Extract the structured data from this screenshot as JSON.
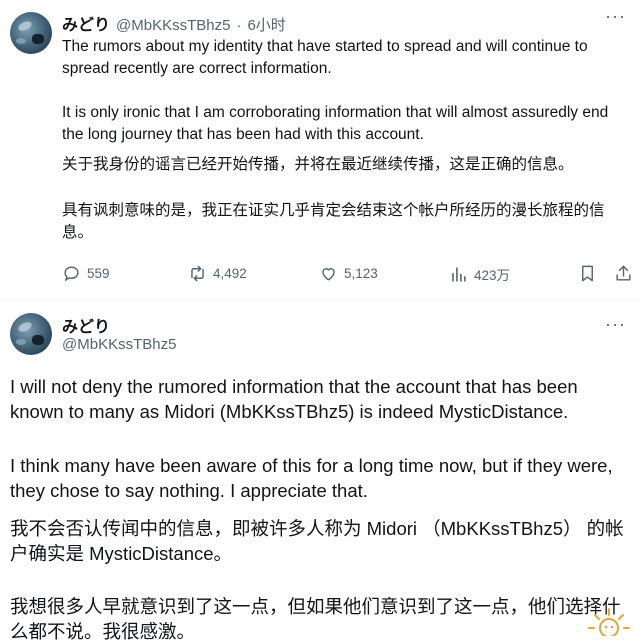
{
  "tweet1": {
    "display_name": "みどり",
    "handle": "@MbKKssTBhz5",
    "separator": "·",
    "time": "6小时",
    "more_label": "···",
    "paragraph1": "The rumors about my identity that have started to spread and will continue to spread recently are correct information.",
    "paragraph2": "It is only ironic that I am corroborating information that will almost assuredly end the long journey that has been had with this account.",
    "paragraph3": "关于我身份的谣言已经开始传播，并将在最近继续传播，这是正确的信息。",
    "paragraph4": "具有讽刺意味的是，我正在证实几乎肯定会结束这个帐户所经历的漫长旅程的信息。",
    "actions": {
      "replies": "559",
      "reposts": "4,492",
      "likes": "5,123",
      "views": "423万"
    },
    "icons": [
      "reply-icon",
      "repost-icon",
      "like-icon",
      "views-icon",
      "bookmark-icon",
      "share-icon"
    ]
  },
  "tweet2": {
    "display_name": "みどり",
    "handle": "@MbKKssTBhz5",
    "more_label": "···",
    "paragraph1": "I will not deny the rumored information that the account that has been known to many as Midori (MbKKssTBhz5) is indeed MysticDistance.",
    "paragraph2": "I think many have been aware of this for a long time now, but if they were, they chose to say nothing. I appreciate that.",
    "paragraph3": "我不会否认传闻中的信息，即被许多人称为 Midori （MbKKssTBhz5） 的帐户确实是 MysticDistance。",
    "paragraph4": "我想很多人早就意识到了这一点，但如果他们意识到了这一点，他们选择什么都不说。我很感激。"
  },
  "colors": {
    "text": "#0f1419",
    "secondary": "#536471",
    "divider": "#eff3f4",
    "watermark": "#e8a33b"
  }
}
